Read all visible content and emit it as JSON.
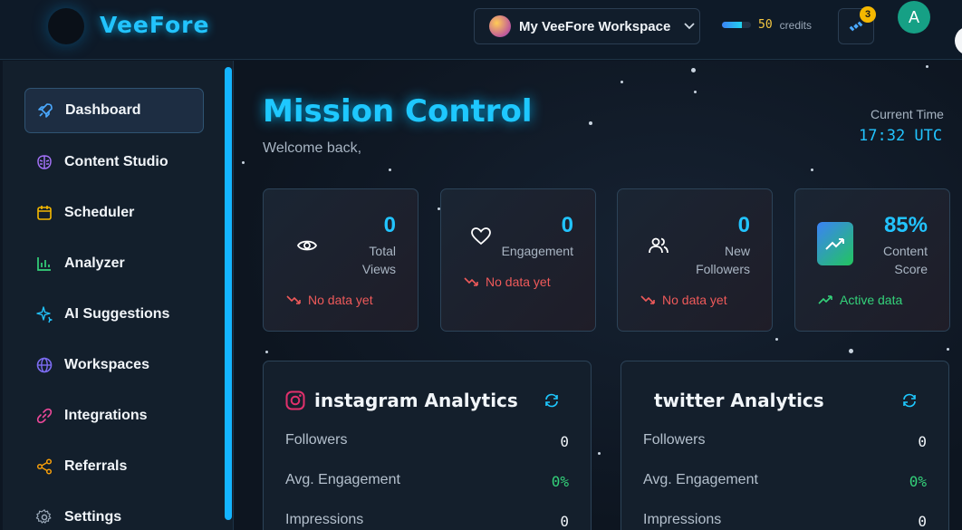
{
  "brand": {
    "name": "VeeFore"
  },
  "header": {
    "workspace_label": "My VeeFore Workspace",
    "credits_value": "50",
    "credits_label": "credits",
    "credits_fill_percent": 70,
    "notification_count": "3",
    "user_initial": "A"
  },
  "sidebar": {
    "items": [
      {
        "label": "Dashboard",
        "icon": "rocket-icon",
        "active": true
      },
      {
        "label": "Content Studio",
        "icon": "brain-icon"
      },
      {
        "label": "Scheduler",
        "icon": "calendar-icon"
      },
      {
        "label": "Analyzer",
        "icon": "bar-chart-icon"
      },
      {
        "label": "AI Suggestions",
        "icon": "sparkles-icon"
      },
      {
        "label": "Workspaces",
        "icon": "globe-icon"
      },
      {
        "label": "Integrations",
        "icon": "link-icon"
      },
      {
        "label": "Referrals",
        "icon": "share-icon"
      },
      {
        "label": "Settings",
        "icon": "gear-icon"
      }
    ]
  },
  "main": {
    "title": "Mission Control",
    "welcome": "Welcome back,",
    "time_label": "Current Time",
    "time_value": "17:32 UTC"
  },
  "stats": [
    {
      "value": "0",
      "label_line1": "Total",
      "label_line2": "Views",
      "note": "No data yet",
      "icon": "eye-icon",
      "status": "negative"
    },
    {
      "value": "0",
      "label_line1": "Engagement",
      "label_line2": "",
      "note": "No data yet",
      "icon": "heart-icon",
      "status": "negative"
    },
    {
      "value": "0",
      "label_line1": "New",
      "label_line2": "Followers",
      "note": "No data yet",
      "icon": "users-icon",
      "status": "negative"
    },
    {
      "value": "85%",
      "label_line1": "Content",
      "label_line2": "Score",
      "note": "Active data",
      "icon": "trending-up-icon",
      "status": "positive"
    }
  ],
  "panels": [
    {
      "title": "instagram Analytics",
      "rows": [
        {
          "label": "Followers",
          "value": "0"
        },
        {
          "label": "Avg. Engagement",
          "value": "0%"
        },
        {
          "label": "Impressions",
          "value": "0"
        }
      ]
    },
    {
      "title": "twitter Analytics",
      "rows": [
        {
          "label": "Followers",
          "value": "0"
        },
        {
          "label": "Avg. Engagement",
          "value": "0%"
        },
        {
          "label": "Impressions",
          "value": "0"
        }
      ]
    }
  ],
  "colors": {
    "accent": "#22c4ff",
    "negative": "#ef5a5a",
    "positive": "#34d27a",
    "credits": "#f5c842"
  }
}
